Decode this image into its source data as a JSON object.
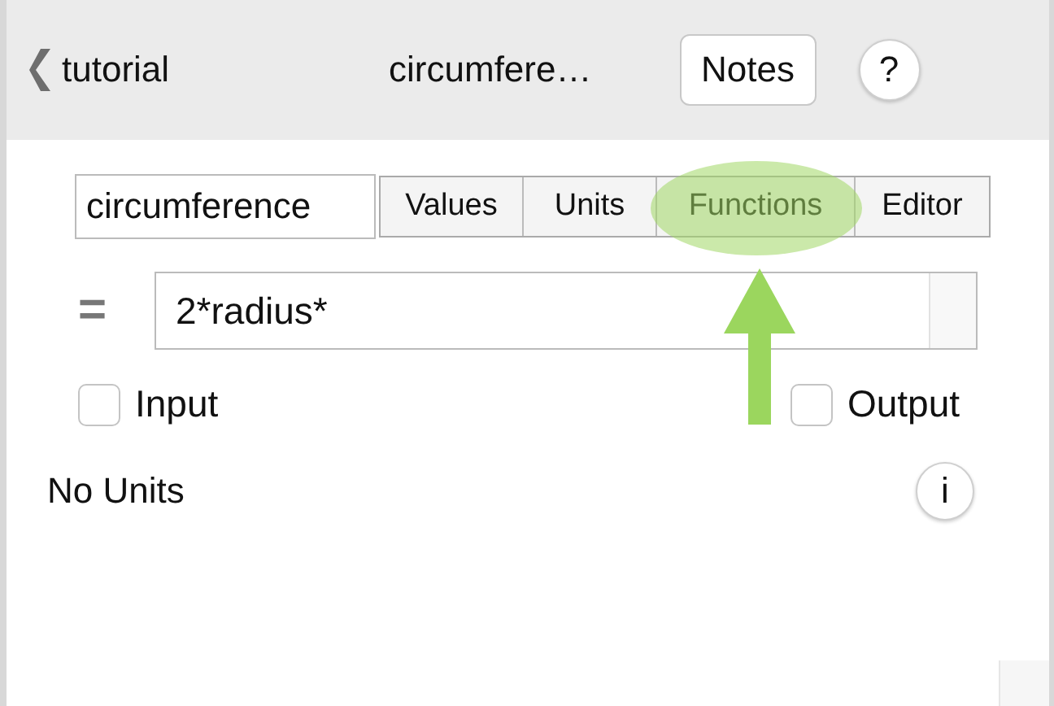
{
  "nav": {
    "back_label": "tutorial",
    "title": "circumfere…",
    "notes_button": "Notes",
    "help_button": "?"
  },
  "name_field": {
    "value": "circumference"
  },
  "tabs": [
    {
      "label": "Values",
      "selected": false,
      "highlighted": false
    },
    {
      "label": "Units",
      "selected": false,
      "highlighted": false
    },
    {
      "label": "Functions",
      "selected": false,
      "highlighted": true
    },
    {
      "label": "Editor",
      "selected": false,
      "highlighted": false
    }
  ],
  "formula": {
    "sign": "=",
    "value": "2*radius*"
  },
  "checkboxes": [
    {
      "label": "Input",
      "checked": false
    },
    {
      "label": "Output",
      "checked": false
    }
  ],
  "units": {
    "text": "No Units",
    "info_button": "i"
  }
}
